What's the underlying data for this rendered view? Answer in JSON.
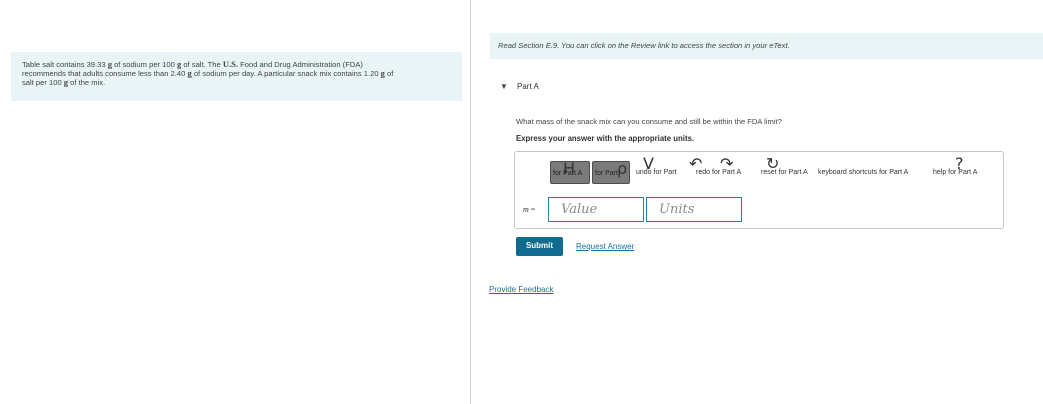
{
  "problem": {
    "line1_pre": "Table salt contains 39.33 ",
    "unit_g": "g",
    "line1_mid": " of sodium per 100 ",
    "line1_mid2": " of salt. The ",
    "us": "U.S.",
    "line1_post": " Food and Drug Administration (FDA)",
    "line2_pre": "recommends that adults consume less than 2.40 ",
    "line2_post": " of sodium per day. A particular snack mix contains 1.20 ",
    "line2_end": " of",
    "line3_pre": "salt per 100 ",
    "line3_post": " of the mix."
  },
  "banner": {
    "text": "Read Section E.9. You can click on the Review link to access the section in your eText."
  },
  "part": {
    "toggle_icon": "▼",
    "label": "Part A"
  },
  "question": {
    "text": "What mass of the snack mix can you consume and still be within the FDA limit?",
    "instruction": "Express your answer with the appropriate units."
  },
  "toolbar": {
    "templates_label": "for Part A",
    "templates_glyph": "H",
    "symbols_label": "for Part",
    "symbols_glyph": "ρ",
    "undo_glyph": "V",
    "undo_text": "undo for Part",
    "undo_icon": "↶",
    "redo_text": "redo for Part A",
    "redo_icon": "↷",
    "reset_text": "reset for Part A",
    "reset_icon": "↻",
    "keyboard_text": "keyboard shortcuts for Part A",
    "help_text": "help for Part A",
    "help_glyph": "?"
  },
  "answer": {
    "variable": "m",
    "equals": " =",
    "value_placeholder": "Value",
    "units_placeholder": "Units"
  },
  "actions": {
    "submit": "Submit",
    "request_answer": "Request Answer",
    "provide_feedback": "Provide Feedback"
  }
}
